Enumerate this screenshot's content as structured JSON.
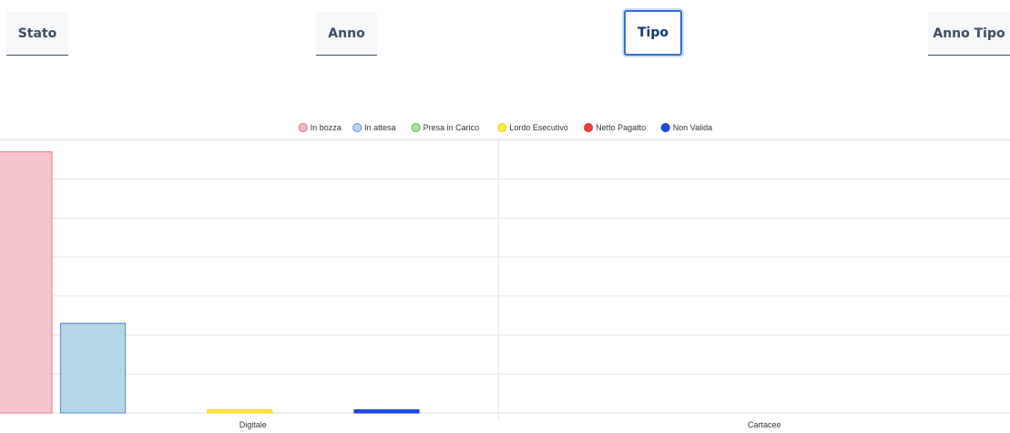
{
  "tabs": [
    {
      "id": "tab-stato",
      "label": "Stato",
      "active": false
    },
    {
      "id": "tab-anno",
      "label": "Anno",
      "active": false
    },
    {
      "id": "tab-tipo",
      "label": "Tipo",
      "active": true
    },
    {
      "id": "tab-anno-tipo",
      "label": "Anno Tipo",
      "active": false
    }
  ],
  "chart_data": {
    "type": "bar",
    "title": "",
    "xlabel": "",
    "ylabel": "",
    "categories": [
      "Digitale",
      "Cartacee"
    ],
    "ylim": [
      0,
      7
    ],
    "grid": true,
    "legend_position": "top",
    "series": [
      {
        "name": "In bozza",
        "values": [
          6.7,
          0
        ],
        "fill": "#f4c5cd",
        "stroke": "#e57b86",
        "legend_fill": "#f5b9c4",
        "legend_stroke": "#e46a7a"
      },
      {
        "name": "In attesa",
        "values": [
          2.3,
          0
        ],
        "fill": "#b5d6e5",
        "stroke": "#4d80e6",
        "legend_fill": "#b9d6ee",
        "legend_stroke": "#5c8ee0"
      },
      {
        "name": "Presa in Carico",
        "values": [
          0,
          0
        ],
        "fill": "#a6e39c",
        "stroke": "#5bb24c",
        "legend_fill": "#a6e39c",
        "legend_stroke": "#5bb24c"
      },
      {
        "name": "Lordo Esecutivo",
        "values": [
          0.08,
          0
        ],
        "fill": "#ffe84d",
        "stroke": "#f5cf00",
        "legend_fill": "#ffe84d",
        "legend_stroke": "#f5cf00"
      },
      {
        "name": "Netto Pagatto",
        "values": [
          0,
          0
        ],
        "fill": "#e8443a",
        "stroke": "#e8443a",
        "legend_fill": "#e8443a",
        "legend_stroke": "#d03028"
      },
      {
        "name": "Non Valida",
        "values": [
          0.08,
          0
        ],
        "fill": "#1f4fe6",
        "stroke": "#0a37d0",
        "legend_fill": "#1f4fe6",
        "legend_stroke": "#0a37d0"
      }
    ]
  }
}
